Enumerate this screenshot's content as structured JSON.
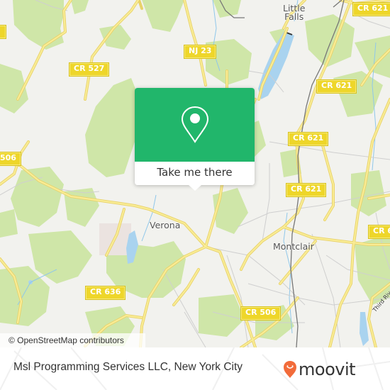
{
  "map": {
    "place_labels": [
      {
        "id": "little-falls",
        "text_lines": [
          "Little",
          "Falls"
        ]
      },
      {
        "id": "verona",
        "text_lines": [
          "Verona"
        ]
      },
      {
        "id": "montclair",
        "text_lines": [
          "Montclair"
        ]
      }
    ],
    "street_labels": [
      {
        "id": "third-river",
        "text": "Third River"
      }
    ],
    "road_shields": [
      {
        "id": "cr-621-top-right",
        "text": "CR 621"
      },
      {
        "id": "cr-527",
        "text": "CR 527"
      },
      {
        "id": "nj-23",
        "text": "NJ 23"
      },
      {
        "id": "cr-621-a",
        "text": "CR 621"
      },
      {
        "id": "cr-621-b",
        "text": "CR 621"
      },
      {
        "id": "cr-506-left",
        "text": "506"
      },
      {
        "id": "cr-621-c",
        "text": "CR 621"
      },
      {
        "id": "cr-621-right",
        "text": "CR 6"
      },
      {
        "id": "cr-636",
        "text": "CR 636"
      },
      {
        "id": "cr-506",
        "text": "CR 506"
      }
    ],
    "colors": {
      "land": "#f2f2ee",
      "park": "#cfe6a8",
      "water": "#a9d3ef",
      "road_major": "#f5e27a",
      "road_minor": "#c9c9c9",
      "rail": "#6b6b6b"
    }
  },
  "popup": {
    "action_label": "Take me there",
    "icon": "map-pin-icon",
    "color": "#21b66b"
  },
  "attribution": {
    "text": "© OpenStreetMap contributors"
  },
  "footer": {
    "title": "Msl Programming Services LLC, New York City",
    "brand": {
      "name": "moovit",
      "icon": "moovit-pin-icon",
      "pin_color": "#f26b3a"
    }
  }
}
